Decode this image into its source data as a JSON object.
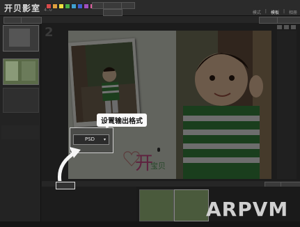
{
  "app": {
    "title": "开贝影室",
    "version": "4.0"
  },
  "toolbar": {
    "swatch_colors": [
      "#d84b4b",
      "#e0a040",
      "#f0e040",
      "#48b048",
      "#40a0d0",
      "#4060d0",
      "#a050c0",
      "#e060a0",
      "#e8e8e8",
      "#999999",
      "#c0c0c0",
      "#888888"
    ],
    "right_menu": [
      "模式",
      "|",
      "模板",
      "|",
      "相册"
    ],
    "right_menu_selected": "模板"
  },
  "page": {
    "number": "2"
  },
  "callout": {
    "text": "设置输出格式"
  },
  "export": {
    "format": "PSD",
    "dropdown_icon": "dropdown-arrow-icon"
  },
  "canvas_art": {
    "title_char": "开",
    "subtitle_chars": "宝贝"
  },
  "watermark": {
    "text": "ARPVM"
  }
}
